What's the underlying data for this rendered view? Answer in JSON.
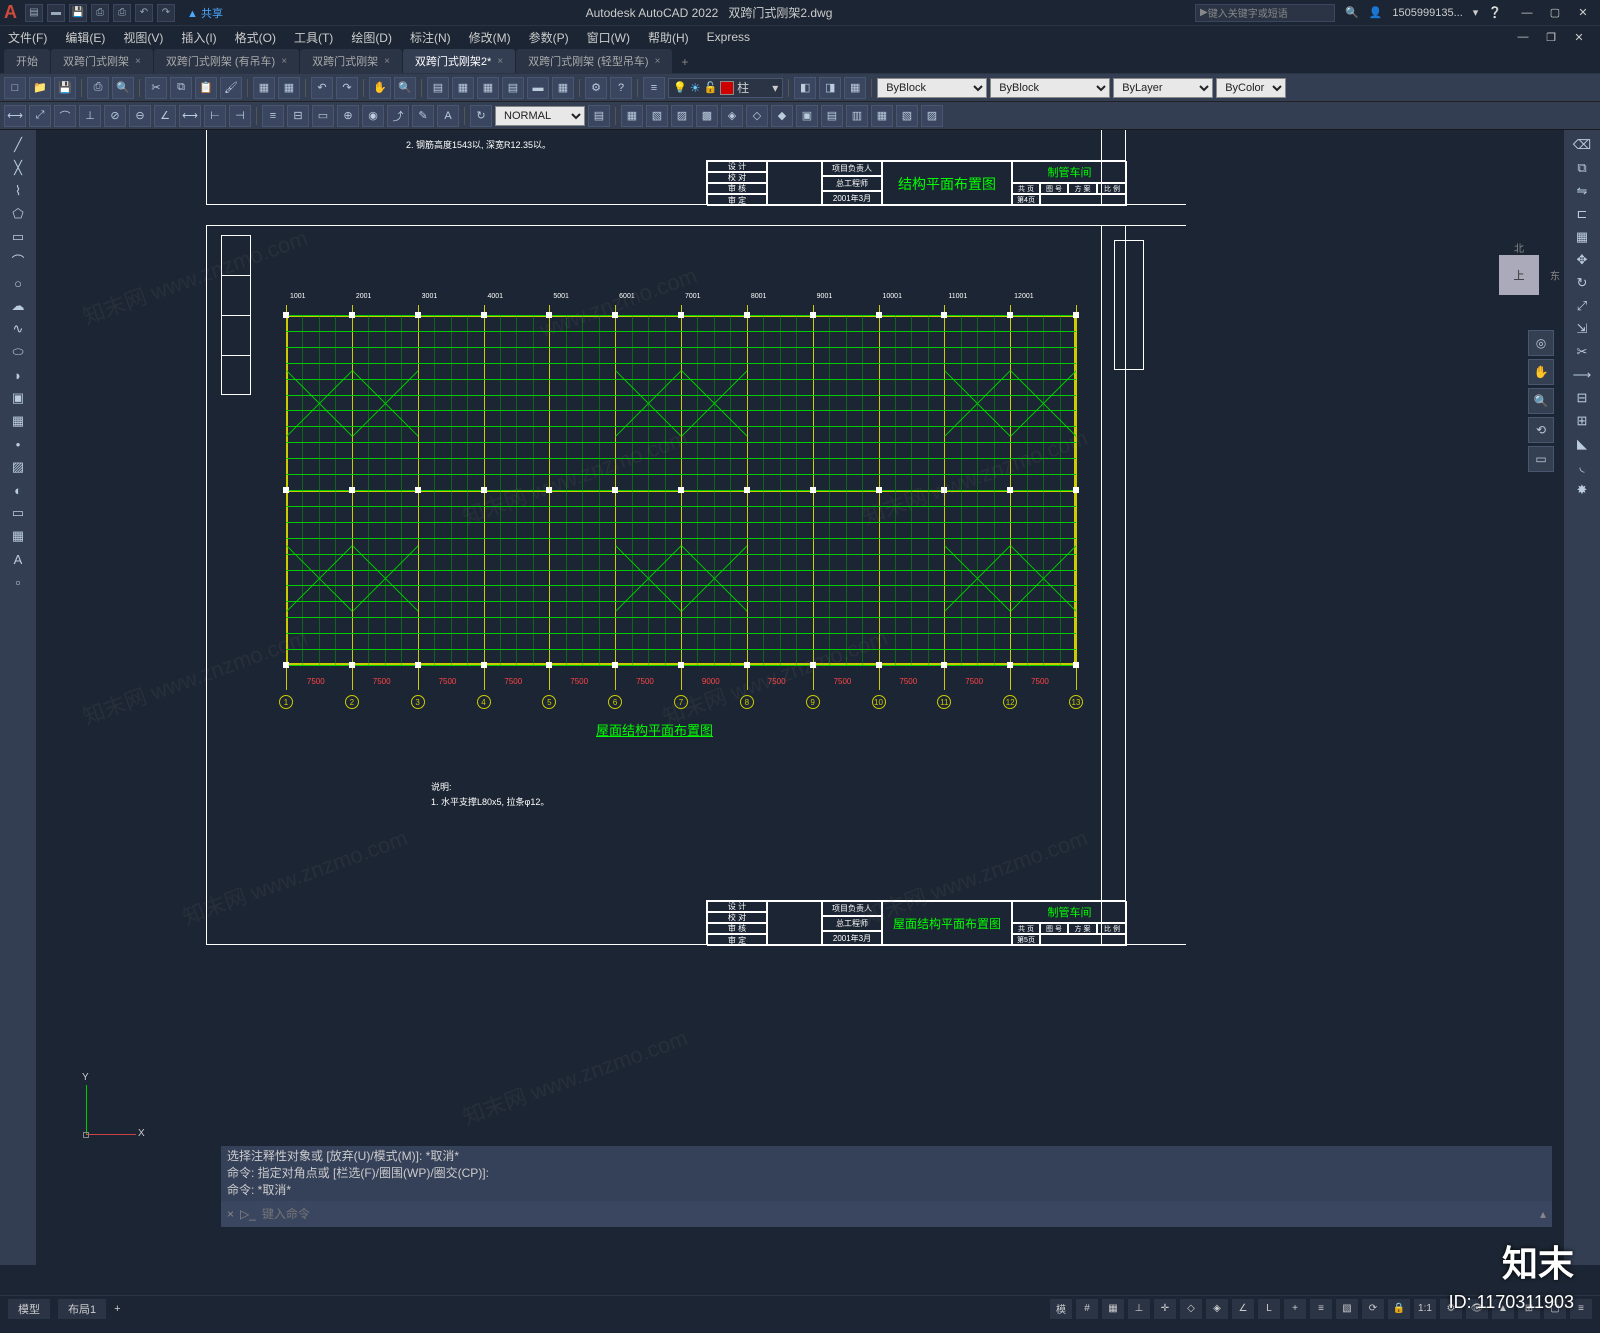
{
  "title": {
    "app": "Autodesk AutoCAD 2022",
    "file": "双跨门式刚架2.dwg"
  },
  "share": "共享",
  "search_placeholder": "键入关键字或短语",
  "user": "1505999135...",
  "menus": [
    "文件(F)",
    "编辑(E)",
    "视图(V)",
    "插入(I)",
    "格式(O)",
    "工具(T)",
    "绘图(D)",
    "标注(N)",
    "修改(M)",
    "参数(P)",
    "窗口(W)",
    "帮助(H)",
    "Express"
  ],
  "doctabs": {
    "items": [
      {
        "label": "开始"
      },
      {
        "label": "双跨门式刚架"
      },
      {
        "label": "双跨门式刚架 (有吊车)"
      },
      {
        "label": "双跨门式刚架"
      },
      {
        "label": "双跨门式刚架2*",
        "active": true
      },
      {
        "label": "双跨门式刚架 (轻型吊车)"
      }
    ]
  },
  "toolbar1": {
    "style_select": "NORMAL",
    "layer_current": "柱",
    "prop_color": "ByBlock",
    "prop_linetype": "ByBlock",
    "prop_lineweight": "ByLayer",
    "prop_plot": "ByColor"
  },
  "viewcube": {
    "face": "上",
    "n": "北",
    "e": "东"
  },
  "drawing": {
    "titleblock1": {
      "project": "项目负责人",
      "eng": "总工程师",
      "date": "2001年3月",
      "name": "结构平面布置图",
      "workshop": "制管车间",
      "cols": [
        "设 计",
        "校 对",
        "审 核",
        "审 定"
      ],
      "right_cols": [
        "共 页",
        "图 号",
        "方 案",
        "比 例"
      ],
      "sheet": "第4页"
    },
    "titleblock2": {
      "project": "项目负责人",
      "eng": "总工程师",
      "date": "2001年3月",
      "name": "屋面结构平面布置图",
      "workshop": "制管车间",
      "sheet": "第5页",
      "right_cols": [
        "共 页",
        "图 号",
        "方 案",
        "比 例"
      ]
    },
    "plan_title": "屋面结构平面布置图",
    "notes": {
      "head": "说明:",
      "line1": "1. 水平支撑L80x5, 拉条φ12。"
    },
    "note_top": "2. 钢筋高度1543以, 深宽R12.35以。",
    "spans": [
      "7500",
      "7500",
      "7500",
      "7500",
      "7500",
      "7500",
      "9000",
      "7500",
      "7500",
      "7500",
      "7500",
      "7500"
    ],
    "axis_labels": [
      "1",
      "2",
      "3",
      "4",
      "5",
      "6",
      "7",
      "8",
      "9",
      "10",
      "11",
      "12",
      "13"
    ],
    "col_marks": [
      "1001",
      "2001",
      "3001",
      "4001",
      "5001",
      "6001",
      "7001",
      "8001",
      "9001",
      "10001",
      "11001",
      "12001"
    ]
  },
  "cmd": {
    "h1": "选择注释性对象或 [放弃(U)/模式(M)]: *取消*",
    "h2": "命令: 指定对角点或 [栏选(F)/圈围(WP)/圈交(CP)]:",
    "h3": "命令: *取消*",
    "placeholder": "键入命令"
  },
  "status": {
    "model": "模型",
    "layout": "布局1"
  },
  "watermark": {
    "text": "www.znzmo.com",
    "cn": "知末网",
    "logo": "知末",
    "id": "ID: 1170311903"
  }
}
